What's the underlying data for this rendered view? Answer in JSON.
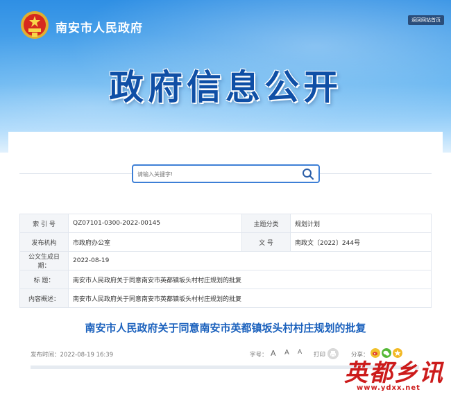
{
  "header": {
    "site_name": "南安市人民政府",
    "home_link": "返回网站首页",
    "banner_title": "政府信息公开"
  },
  "search": {
    "placeholder": "请输入关键字!"
  },
  "info_table": {
    "index_label": "索 引 号",
    "index_value": "QZ07101-0300-2022-00145",
    "topic_label": "主题分类",
    "topic_value": "规划计划",
    "issuer_label": "发布机构",
    "issuer_value": "市政府办公室",
    "docno_label": "文 号",
    "docno_value": "南政文〔2022〕244号",
    "date_label": "公文生成日期：",
    "date_value": "2022-08-19",
    "title_label": "标 题：",
    "title_value": "南安市人民政府关于同意南安市英都镇坂头村村庄规划的批复",
    "summary_label": "内容概述：",
    "summary_value": "南安市人民政府关于同意南安市英都镇坂头村村庄规划的批复"
  },
  "document": {
    "title": "南安市人民政府关于同意南安市英都镇坂头村村庄规划的批复",
    "publish_time": "发布时间：2022-08-19 16:39",
    "font_size_label": "字号：",
    "font_large": "A",
    "font_medium": "A",
    "font_small": "A",
    "print_label": "打印",
    "share_label": "分享："
  },
  "watermark": {
    "chars": "英都乡讯",
    "url": "www.ydxx.net"
  },
  "colors": {
    "accent": "#1b61bd",
    "banner_title": "#0f4fa6",
    "watermark": "#cc1b1b"
  }
}
